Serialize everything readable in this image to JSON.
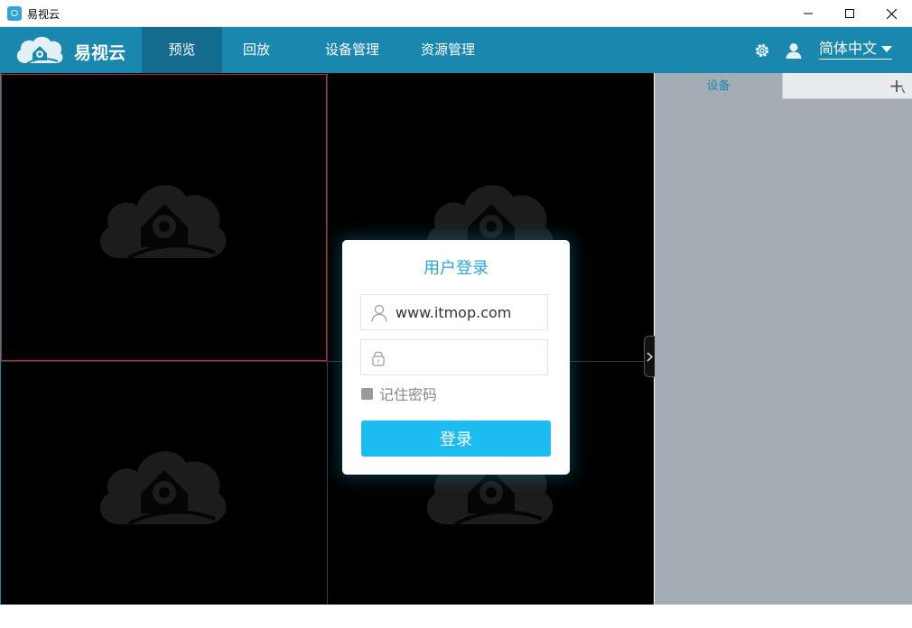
{
  "window": {
    "title": "易视云",
    "icons": {
      "app": "app-logo-icon",
      "minimize": "minimize-icon",
      "maximize": "maximize-icon",
      "close": "close-icon"
    }
  },
  "header": {
    "brand": "易视云",
    "tabs": [
      {
        "label": "预览",
        "active": true
      },
      {
        "label": "回放",
        "active": false
      },
      {
        "label": "设备管理",
        "active": false
      },
      {
        "label": "资源管理",
        "active": false
      }
    ],
    "icons": {
      "settings": "gear-icon",
      "user": "user-icon"
    },
    "language": "简体中文"
  },
  "panel": {
    "tabs": {
      "device": "设备"
    },
    "icons": {
      "add": "plus-icon",
      "collapse": "chevron-right-icon"
    }
  },
  "login": {
    "title": "用户登录",
    "username_value": "www.itmop.com",
    "password_value": "",
    "remember_label": "记住密码",
    "remember_checked": false,
    "submit_label": "登录",
    "icons": {
      "username": "user-outline-icon",
      "password": "lock-icon"
    }
  },
  "colors": {
    "header_bg": "#1a87ae",
    "active_tab_bg": "#136c8d",
    "login_button": "#1cbcf1",
    "selected_cell_border": "#b5272b",
    "side_panel_bg": "#a3adb3"
  }
}
